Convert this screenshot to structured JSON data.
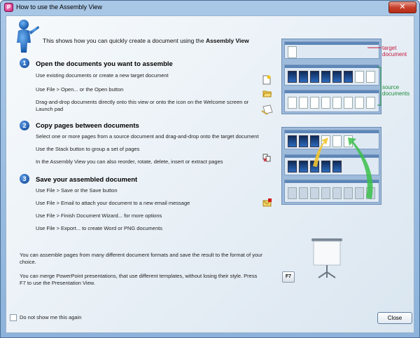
{
  "window": {
    "title": "How to use the Assembly View",
    "close_glyph": "✕"
  },
  "intro": {
    "text": "This shows how you can quickly create a document using the ",
    "bold": "Assembly View"
  },
  "sections": [
    {
      "number": "1",
      "title": "Open the documents you want to assemble",
      "lines": [
        "Use existing documents or create a new target document",
        "Use File > Open... or the Open button",
        "Drag-and-drop documents directly onto this view or onto the icon on the Welcome screen or",
        "Launch pad"
      ]
    },
    {
      "number": "2",
      "title": "Copy pages between documents",
      "lines": [
        "Select one or more pages from a source document and drag-and-drop onto the target document",
        "Use the Stack button to group a set of pages",
        "In the Assembly View you can also reorder, rotate, delete, insert or extract pages"
      ]
    },
    {
      "number": "3",
      "title": "Save your assembled document",
      "lines": [
        "Use File > Save or the Save button",
        "Use File > Email to attach your document to a new email message",
        "Use File > Finish Document Wizard... for more options",
        "Use File > Export... to create Word or PNG documents"
      ]
    }
  ],
  "annotations": {
    "target_l1": "target",
    "target_l2": "document",
    "source_l1": "source",
    "source_l2": "documents"
  },
  "notes": {
    "formats_l1": "You can assemble pages from many different document formats and save the result to the format of your",
    "formats_l2": "choice.",
    "ppt_l1": "You can merge PowerPoint presentations, that use different templates, without losing their style.  Press",
    "ppt_l2": "F7 to use the Presentation View."
  },
  "f7_key": "F7",
  "footer": {
    "checkbox_label": "Do not show me this again",
    "close_label": "Close"
  },
  "colors": {
    "target_annotation": "#c4183c",
    "source_annotation": "#1d8b3c",
    "section_badge": "#0b3f8e"
  },
  "icons": [
    "person-guide-icon",
    "new-document-icon",
    "open-folder-icon",
    "drag-drop-icon",
    "stack-icon",
    "email-icon",
    "projector-screen-icon"
  ]
}
